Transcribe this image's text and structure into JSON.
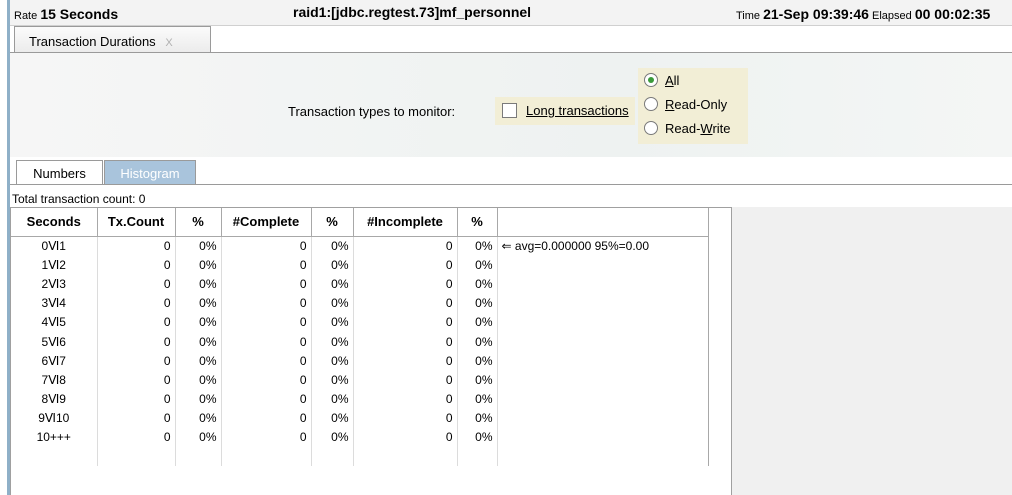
{
  "status_bar": {
    "rate_prefix": "Rate",
    "rate_value": "15 Seconds",
    "connection": "raid1:[jdbc.regtest.73]mf_personnel",
    "time_prefix": "Time",
    "time_value": "21-Sep 09:39:46",
    "elapsed_prefix": "Elapsed",
    "elapsed_value": "00 00:02:35"
  },
  "window_tab": {
    "label": "Transaction Durations",
    "close_glyph": "X"
  },
  "controls": {
    "monitor_label": "Transaction types to monitor:",
    "long_transactions_label": "Long transactions",
    "long_transactions_checked": false,
    "radio_options": [
      {
        "label": "All",
        "mnemonic": "A",
        "selected": true
      },
      {
        "label": "Read-Only",
        "mnemonic": "R",
        "selected": false
      },
      {
        "label": "Read-Write",
        "mnemonic": "W",
        "selected": false
      }
    ]
  },
  "sub_tabs": [
    {
      "label": "Numbers",
      "active": true
    },
    {
      "label": "Histogram",
      "active": false
    }
  ],
  "total_count_label": "Total transaction count:  0",
  "table": {
    "headers": [
      "Seconds",
      "Tx.Count",
      "%",
      "#Complete",
      "%",
      "#Incomplete",
      "%",
      ""
    ],
    "rows": [
      [
        "0Ⅵ1",
        "0",
        "0%",
        "0",
        "0%",
        "0",
        "0%",
        "⇐ avg=0.000000 95%=0.00"
      ],
      [
        "1Ⅵ2",
        "0",
        "0%",
        "0",
        "0%",
        "0",
        "0%",
        ""
      ],
      [
        "2Ⅵ3",
        "0",
        "0%",
        "0",
        "0%",
        "0",
        "0%",
        ""
      ],
      [
        "3Ⅵ4",
        "0",
        "0%",
        "0",
        "0%",
        "0",
        "0%",
        ""
      ],
      [
        "4Ⅵ5",
        "0",
        "0%",
        "0",
        "0%",
        "0",
        "0%",
        ""
      ],
      [
        "5Ⅵ6",
        "0",
        "0%",
        "0",
        "0%",
        "0",
        "0%",
        ""
      ],
      [
        "6Ⅵ7",
        "0",
        "0%",
        "0",
        "0%",
        "0",
        "0%",
        ""
      ],
      [
        "7Ⅵ8",
        "0",
        "0%",
        "0",
        "0%",
        "0",
        "0%",
        ""
      ],
      [
        "8Ⅵ9",
        "0",
        "0%",
        "0",
        "0%",
        "0",
        "0%",
        ""
      ],
      [
        "9Ⅵ10",
        "0",
        "0%",
        "0",
        "0%",
        "0",
        "0%",
        ""
      ],
      [
        "10+++",
        "0",
        "0%",
        "0",
        "0%",
        "0",
        "0%",
        ""
      ],
      [
        "",
        "",
        "",
        "",
        "",
        "",
        "",
        ""
      ]
    ]
  }
}
